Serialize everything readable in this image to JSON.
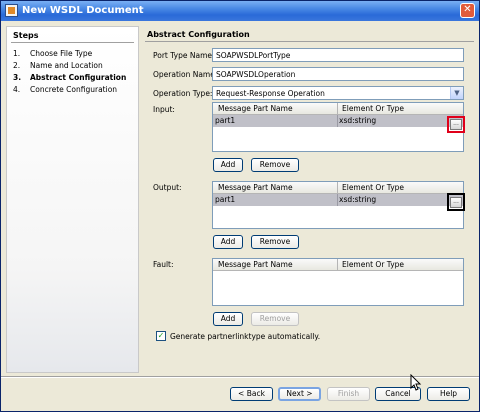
{
  "window": {
    "title": "New WSDL Document",
    "close_glyph": "✕"
  },
  "steps": {
    "heading": "Steps",
    "items": [
      {
        "num": "1.",
        "label": "Choose File Type"
      },
      {
        "num": "2.",
        "label": "Name and Location"
      },
      {
        "num": "3.",
        "label": "Abstract Configuration"
      },
      {
        "num": "4.",
        "label": "Concrete Configuration"
      }
    ]
  },
  "main": {
    "heading": "Abstract Configuration",
    "port_type": {
      "label": "Port Type Name:",
      "value": "SOAPWSDLPortType"
    },
    "operation_name": {
      "label": "Operation Name:",
      "value": "SOAPWSDLOperation"
    },
    "operation_type": {
      "label": "Operation Type:",
      "value": "Request-Response Operation"
    },
    "columns": {
      "part": "Message Part Name",
      "type": "Element Or Type"
    },
    "input": {
      "label": "Input:",
      "row": {
        "part": "part1",
        "type": "xsd:string"
      },
      "add": "Add",
      "remove": "Remove"
    },
    "output": {
      "label": "Output:",
      "row": {
        "part": "part1",
        "type": "xsd:string"
      },
      "add": "Add",
      "remove": "Remove"
    },
    "fault": {
      "label": "Fault:",
      "add": "Add",
      "remove": "Remove"
    },
    "partnerlink_checkbox": {
      "label": "Generate partnerlinktype automatically.",
      "checked": true
    }
  },
  "footer": {
    "back": "< Back",
    "next": "Next >",
    "finish": "Finish",
    "cancel": "Cancel",
    "help": "Help"
  },
  "ellipsis_glyph": "...",
  "check_glyph": "✓",
  "combo_glyph": "▼",
  "colors": {
    "highlight_red": "#e0001a",
    "highlight_black": "#000000",
    "title_blue": "#2a6ad8"
  }
}
